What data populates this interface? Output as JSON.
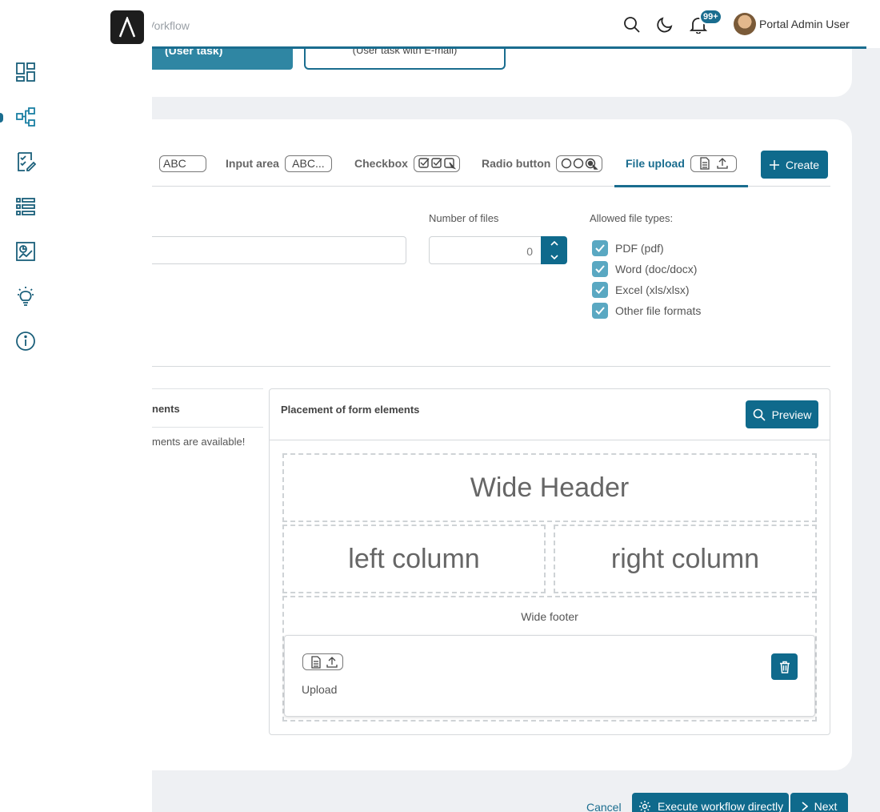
{
  "header": {
    "breadcrumb_fragment": "Vorkflow",
    "notification_count": "99+",
    "user_name": "Portal Admin User"
  },
  "workflow_steps": [
    {
      "label": "(User task)"
    },
    {
      "label": "(User task with E-mail)"
    }
  ],
  "tabs": [
    {
      "label": "",
      "icon_text": "ABC"
    },
    {
      "label": "Input area",
      "icon_text": "ABC..."
    },
    {
      "label": "Checkbox",
      "icon_name": "checkbox-group-icon"
    },
    {
      "label": "Radio button",
      "icon_name": "radio-group-icon"
    },
    {
      "label": "File upload",
      "icon_name": "file-upload-icon"
    }
  ],
  "create_label": "Create",
  "form": {
    "number_of_files_label": "Number of files",
    "number_of_files_value": "0",
    "allowed_types_label": "Allowed file types:",
    "file_types": [
      {
        "label": "PDF (pdf)",
        "checked": true
      },
      {
        "label": "Word (doc/docx)",
        "checked": true
      },
      {
        "label": "Excel (xls/xlsx)",
        "checked": true
      },
      {
        "label": "Other file formats",
        "checked": true
      }
    ]
  },
  "left_panel": {
    "title_fragment": "nents",
    "message_fragment": "ments are available!"
  },
  "placement": {
    "title": "Placement of form elements",
    "preview_label": "Preview",
    "wide_header": "Wide Header",
    "left_column": "left column",
    "right_column": "right column",
    "wide_footer": "Wide footer",
    "upload_element_label": "Upload"
  },
  "actions": {
    "cancel": "Cancel",
    "execute": "Execute workflow directly",
    "next": "Next"
  },
  "colors": {
    "accent": "#0f6a8c",
    "checkbox": "#5aa8c2"
  }
}
